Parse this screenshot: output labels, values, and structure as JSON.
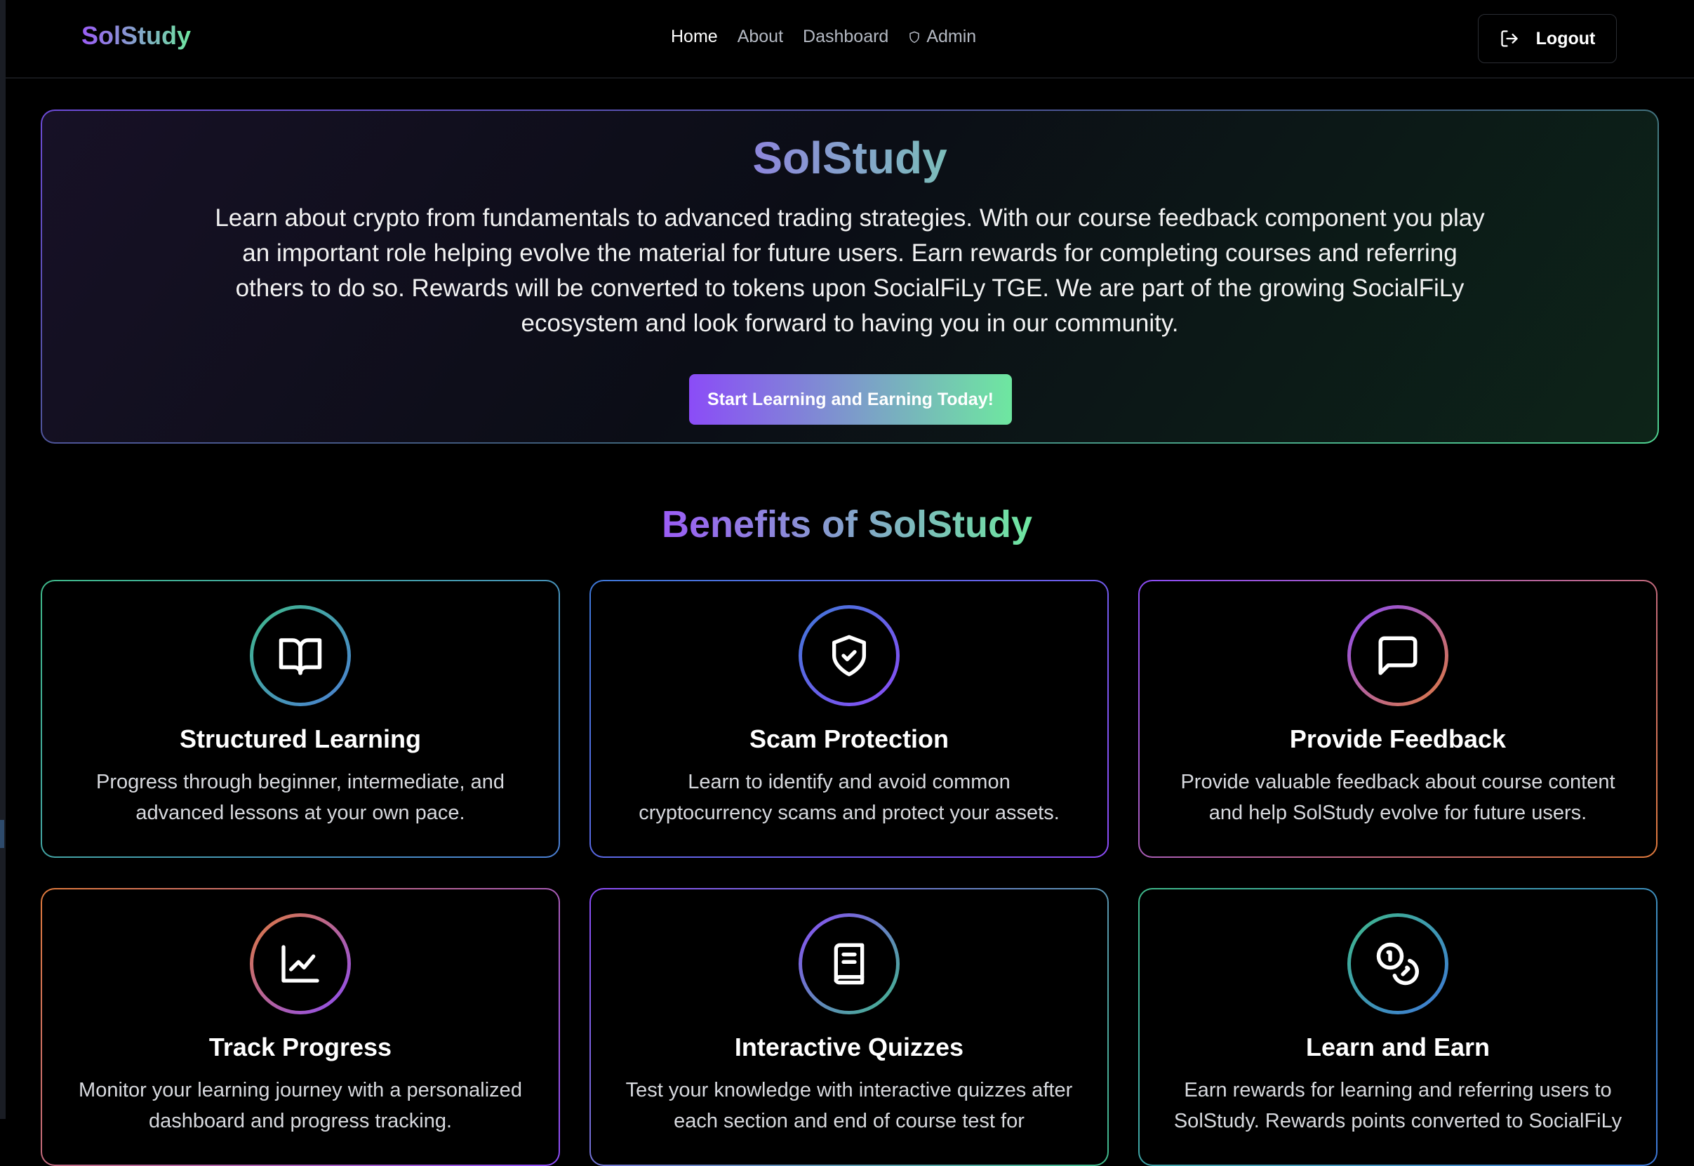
{
  "nav": {
    "brand": "SolStudy",
    "links": [
      {
        "label": "Home",
        "active": true
      },
      {
        "label": "About"
      },
      {
        "label": "Dashboard"
      },
      {
        "label": "Admin",
        "icon": "shield-outline-icon"
      }
    ],
    "logout_label": "Logout",
    "logout_icon": "logout-icon"
  },
  "hero": {
    "title": "SolStudy",
    "description": "Learn about crypto from fundamentals to advanced trading strategies. With our course feedback component you play an important role helping evolve the material for future users. Earn rewards for completing courses and referring others to do so. Rewards will be converted to tokens upon SocialFiLy TGE. We are part of the growing SocialFiLy ecosystem and look forward to having you in our community.",
    "cta_label": "Start Learning and Earning Today!"
  },
  "benefits": {
    "title": "Benefits of SolStudy",
    "cards": [
      {
        "title": "Structured Learning",
        "description": "Progress through beginner, intermediate, and advanced lessons at your own pace.",
        "icon": "book-open-icon"
      },
      {
        "title": "Scam Protection",
        "description": "Learn to identify and avoid common cryptocurrency scams and protect your assets.",
        "icon": "shield-check-icon"
      },
      {
        "title": "Provide Feedback",
        "description": "Provide valuable feedback about course content and help SolStudy evolve for future users.",
        "icon": "message-square-icon"
      },
      {
        "title": "Track Progress",
        "description": "Monitor your learning journey with a personalized dashboard and progress tracking.",
        "icon": "line-chart-icon"
      },
      {
        "title": "Interactive Quizzes",
        "description": "Test your knowledge with interactive quizzes after each section and end of course test for",
        "icon": "book-text-icon"
      },
      {
        "title": "Learn and Earn",
        "description": "Earn rewards for learning and referring users to SolStudy. Rewards points converted to SocialFiLy",
        "icon": "coins-icon"
      }
    ]
  },
  "colors": {
    "background": "#000000",
    "gradient_purple": "#8b4cf7",
    "gradient_green": "#6ee7a0"
  }
}
